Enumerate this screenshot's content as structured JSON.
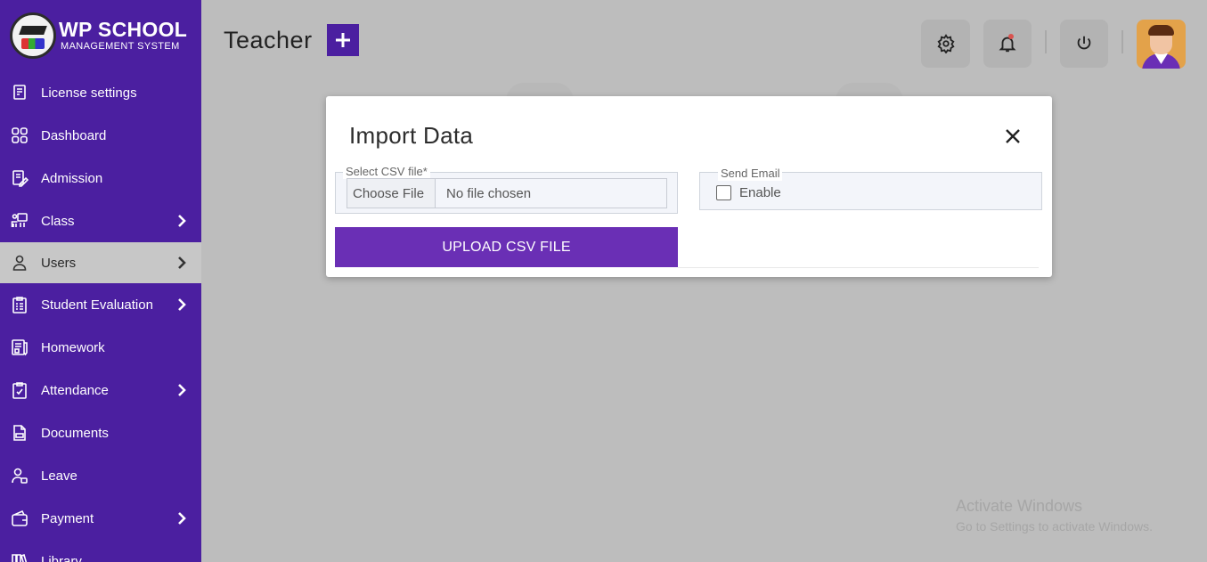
{
  "brand": {
    "title": "WP SCHOOL",
    "subtitle": "MANAGEMENT SYSTEM"
  },
  "sidebar": {
    "items": [
      {
        "label": "License settings",
        "icon": "license-icon",
        "has_submenu": false
      },
      {
        "label": "Dashboard",
        "icon": "dashboard-icon",
        "has_submenu": false
      },
      {
        "label": "Admission",
        "icon": "admission-icon",
        "has_submenu": false
      },
      {
        "label": "Class",
        "icon": "class-icon",
        "has_submenu": true
      },
      {
        "label": "Users",
        "icon": "user-icon",
        "has_submenu": true,
        "active": true
      },
      {
        "label": "Student Evaluation",
        "icon": "evaluation-icon",
        "has_submenu": true
      },
      {
        "label": "Homework",
        "icon": "homework-icon",
        "has_submenu": false
      },
      {
        "label": "Attendance",
        "icon": "attendance-icon",
        "has_submenu": true
      },
      {
        "label": "Documents",
        "icon": "documents-icon",
        "has_submenu": false
      },
      {
        "label": "Leave",
        "icon": "leave-icon",
        "has_submenu": false
      },
      {
        "label": "Payment",
        "icon": "payment-icon",
        "has_submenu": true
      },
      {
        "label": "Library",
        "icon": "library-icon",
        "has_submenu": false
      }
    ]
  },
  "header": {
    "title": "Teacher",
    "icons": [
      "plus-icon",
      "gear-icon",
      "bell-icon",
      "power-icon",
      "avatar"
    ]
  },
  "modal": {
    "title": "Import Data",
    "csv_field": {
      "legend": "Select CSV file*",
      "choose_label": "Choose File",
      "status": "No file chosen"
    },
    "email_field": {
      "legend": "Send Email",
      "checkbox_label": "Enable",
      "checked": false
    },
    "upload_label": "UPLOAD CSV FILE"
  },
  "watermark": {
    "line1": "Activate Windows",
    "line2": "Go to Settings to activate Windows."
  },
  "colors": {
    "sidebar": "#4b1fa0",
    "primary_button": "#6a2fb5",
    "overlay": "#bdbdbd",
    "active_item": "#c7c7c7"
  }
}
